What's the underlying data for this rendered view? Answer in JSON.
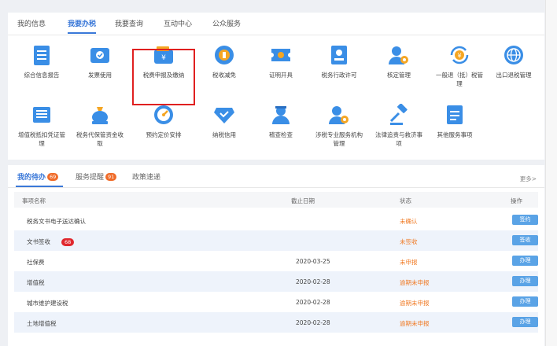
{
  "top_tabs": [
    "我的信息",
    "我要办税",
    "我要查询",
    "互动中心",
    "公众服务"
  ],
  "services_row1": [
    {
      "label": "综合信息报告",
      "icon": "report-doc-icon"
    },
    {
      "label": "发票使用",
      "icon": "invoice-icon"
    },
    {
      "label": "税费申报及缴纳",
      "icon": "wallet-yen-icon"
    },
    {
      "label": "税收减免",
      "icon": "coin-icon"
    },
    {
      "label": "证明开具",
      "icon": "ticket-icon"
    },
    {
      "label": "税务行政许可",
      "icon": "id-card-icon"
    },
    {
      "label": "核定管理",
      "icon": "user-gear-icon"
    },
    {
      "label": "一般退（抵）税管理",
      "icon": "refund-cycle-icon"
    },
    {
      "label": "出口退税管理",
      "icon": "globe-icon"
    }
  ],
  "services_row2": [
    {
      "label": "增值税抵扣凭证管理",
      "icon": "ledger-icon"
    },
    {
      "label": "税务代保管资金收取",
      "icon": "money-bag-icon"
    },
    {
      "label": "预约定价安排",
      "icon": "gauge-icon"
    },
    {
      "label": "纳税信用",
      "icon": "diamond-check-icon"
    },
    {
      "label": "稽查检查",
      "icon": "inspector-icon"
    },
    {
      "label": "涉税专业服务机构管理",
      "icon": "user-gear-icon"
    },
    {
      "label": "法律追责与救济事项",
      "icon": "gavel-icon"
    },
    {
      "label": "其他服务事项",
      "icon": "list-doc-icon"
    }
  ],
  "bottom_tabs": {
    "todo": "我的待办",
    "todo_count": "69",
    "remind": "服务提醒",
    "remind_count": "91",
    "policy": "政策速递",
    "more": "更多>"
  },
  "table": {
    "headers": [
      "事项名称",
      "截止日期",
      "状态",
      "操作"
    ],
    "rows": [
      {
        "name": "税务文书电子送达确认",
        "badge": "",
        "date": "",
        "status": "未确认",
        "action": "签约"
      },
      {
        "name": "文书签收",
        "badge": "68",
        "date": "",
        "status": "未签收",
        "action": "签收"
      },
      {
        "name": "社保费",
        "badge": "",
        "date": "2020-03-25",
        "status": "未申报",
        "action": "办理"
      },
      {
        "name": "增值税",
        "badge": "",
        "date": "2020-02-28",
        "status": "逾期未申报",
        "action": "办理"
      },
      {
        "name": "城市维护建设税",
        "badge": "",
        "date": "2020-02-28",
        "status": "逾期未申报",
        "action": "办理"
      },
      {
        "name": "土地增值税",
        "badge": "",
        "date": "2020-02-28",
        "status": "逾期未申报",
        "action": "办理"
      }
    ]
  },
  "colors": {
    "accent": "#3a78d8",
    "icon_blue": "#3a8ee6",
    "status_orange": "#f07a24",
    "highlight_red": "#e02020"
  }
}
